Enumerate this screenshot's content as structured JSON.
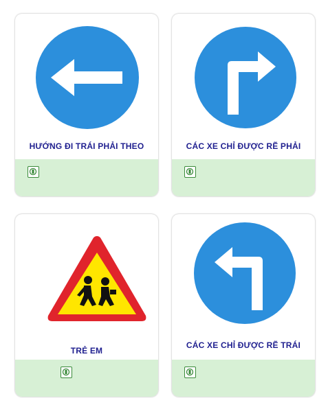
{
  "colors": {
    "sign_blue": "#2c8fdc",
    "caption_blue": "#1f1f8f",
    "warning_red": "#e0242c",
    "warning_yellow": "#ffe600",
    "strip_green": "#d7f0d5",
    "logo_green": "#3a8a3a"
  },
  "cards": [
    {
      "sign": "left-arrow-sign",
      "caption": "HƯỚNG ĐI TRÁI PHẢI THEO",
      "icon": "publisher-logo-icon"
    },
    {
      "sign": "turn-right-sign",
      "caption": "CÁC XE CHỈ ĐƯỢC RẼ PHẢI",
      "icon": "publisher-logo-icon"
    },
    {
      "sign": "children-warning-sign",
      "caption": "TRẺ EM",
      "icon": "publisher-logo-icon"
    },
    {
      "sign": "turn-left-sign",
      "caption": "CÁC XE CHỈ ĐƯỢC RẼ TRÁI",
      "icon": "publisher-logo-icon"
    }
  ]
}
